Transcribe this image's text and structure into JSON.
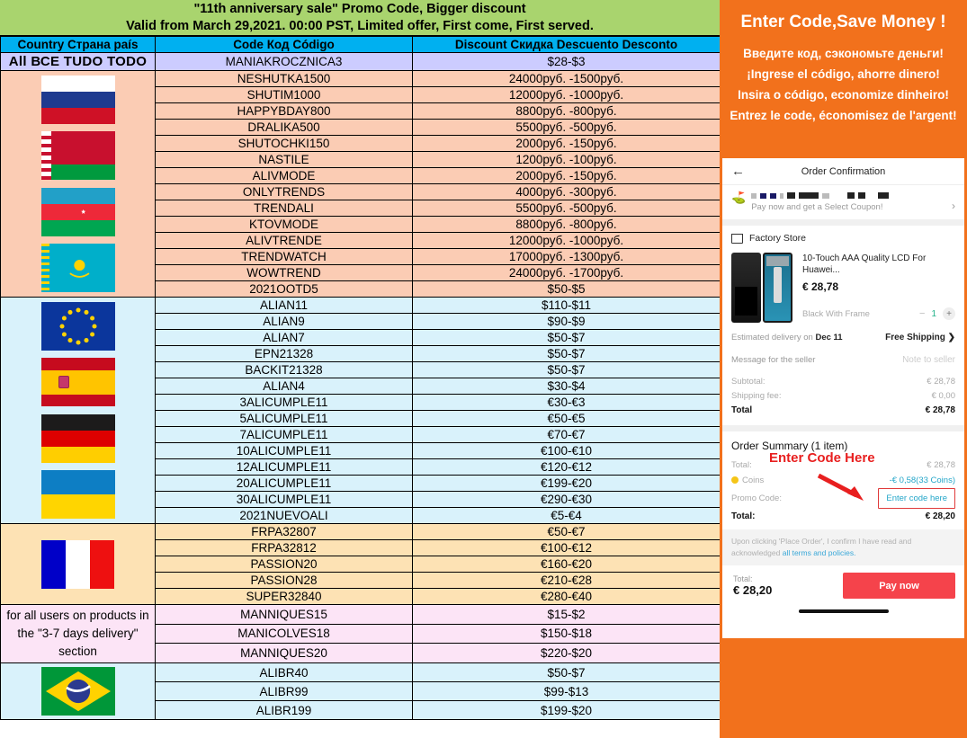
{
  "banner": {
    "line1": "\"11th anniversary sale\" Promo Code, Bigger discount",
    "line2": "Valid from March 29,2021. 00:00 PST, Limited offer, First come, First served."
  },
  "table": {
    "headers": {
      "country": "Country Страна país",
      "code": "Code Код Código",
      "discount": "Discount Скидка Descuento Desconto"
    },
    "all_row": {
      "label": "All ВСЕ TUDO TODO",
      "code": "MANIAKROCZNICA3",
      "discount": "$28-$3"
    },
    "sections": [
      {
        "id": "ru",
        "flags": [
          "russia",
          "belarus",
          "azerbaijan",
          "kazakhstan"
        ],
        "note": "",
        "rows": [
          {
            "code": "NESHUTKA1500",
            "discount": "24000руб. -1500руб."
          },
          {
            "code": "SHUTIM1000",
            "discount": "12000руб. -1000руб."
          },
          {
            "code": "HAPPYBDAY800",
            "discount": "8800руб. -800руб."
          },
          {
            "code": "DRALIKA500",
            "discount": "5500руб. -500руб."
          },
          {
            "code": "SHUTOCHKI150",
            "discount": "2000руб. -150руб."
          },
          {
            "code": "NASTILE",
            "discount": "1200руб. -100руб."
          },
          {
            "code": "ALIVMODE",
            "discount": "2000руб. -150руб."
          },
          {
            "code": "ONLYTRENDS",
            "discount": "4000руб. -300руб."
          },
          {
            "code": "TRENDALI",
            "discount": "5500руб. -500руб."
          },
          {
            "code": "KTOVMODE",
            "discount": "8800руб. -800руб."
          },
          {
            "code": "ALIVTRENDE",
            "discount": "12000руб. -1000руб."
          },
          {
            "code": "TRENDWATCH",
            "discount": "17000руб. -1300руб."
          },
          {
            "code": "WOWTREND",
            "discount": "24000руб. -1700руб."
          },
          {
            "code": "2021OOTD5",
            "discount": "$50-$5"
          }
        ]
      },
      {
        "id": "eu",
        "flags": [
          "eu",
          "spain",
          "germany",
          "ukraine"
        ],
        "note": "",
        "rows": [
          {
            "code": "ALIAN11",
            "discount": "$110-$11"
          },
          {
            "code": "ALIAN9",
            "discount": "$90-$9"
          },
          {
            "code": "ALIAN7",
            "discount": "$50-$7"
          },
          {
            "code": "EPN21328",
            "discount": "$50-$7"
          },
          {
            "code": "BACKIT21328",
            "discount": "$50-$7"
          },
          {
            "code": "ALIAN4",
            "discount": "$30-$4"
          },
          {
            "code": "3ALICUMPLE11",
            "discount": "€30-€3"
          },
          {
            "code": "5ALICUMPLE11",
            "discount": "€50-€5"
          },
          {
            "code": "7ALICUMPLE11",
            "discount": "€70-€7"
          },
          {
            "code": "10ALICUMPLE11",
            "discount": "€100-€10"
          },
          {
            "code": "12ALICUMPLE11",
            "discount": "€120-€12"
          },
          {
            "code": "20ALICUMPLE11",
            "discount": "€199-€20"
          },
          {
            "code": "30ALICUMPLE11",
            "discount": "€290-€30"
          },
          {
            "code": "2021NUEVOALI",
            "discount": "€5-€4"
          }
        ]
      },
      {
        "id": "fr",
        "flags": [
          "france"
        ],
        "note": "",
        "rows": [
          {
            "code": "FRPA32807",
            "discount": "€50-€7"
          },
          {
            "code": "FRPA32812",
            "discount": "€100-€12"
          },
          {
            "code": "PASSION20",
            "discount": "€160-€20"
          },
          {
            "code": "PASSION28",
            "discount": "€210-€28"
          },
          {
            "code": "SUPER32840",
            "discount": "€280-€40"
          }
        ]
      },
      {
        "id": "pt",
        "flags": [],
        "note": "for all users on products in the \"3-7 days delivery\" section",
        "rows": [
          {
            "code": "MANNIQUES15",
            "discount": "$15-$2"
          },
          {
            "code": "MANICOLVES18",
            "discount": "$150-$18"
          },
          {
            "code": "MANNIQUES20",
            "discount": "$220-$20"
          }
        ]
      },
      {
        "id": "br",
        "flags": [
          "brazil"
        ],
        "note": "",
        "rows": [
          {
            "code": "ALIBR40",
            "discount": "$50-$7"
          },
          {
            "code": "ALIBR99",
            "discount": "$99-$13"
          },
          {
            "code": "ALIBR199",
            "discount": "$199-$20"
          }
        ]
      }
    ]
  },
  "panel": {
    "slogan_en": "Enter Code,Save Money !",
    "slogan_ru": "Введите код, сэкономьте деньги!",
    "slogan_es": "¡Ingrese el código, ahorre dinero!",
    "slogan_pt": "Insira o código, economize dinheiro!",
    "slogan_fr": "Entrez le code, économisez de l'argent!",
    "accent_color": "#f2711c"
  },
  "phone": {
    "header_title": "Order Confirmation",
    "back_icon": "←",
    "coupon_subtitle": "Pay now and get a Select Coupon!",
    "chevron": "›",
    "store_name": "Factory Store",
    "item": {
      "title": "10-Touch AAA Quality LCD For Huawei...",
      "price": "€ 28,78",
      "variant": "Black With Frame",
      "qty_minus": "−",
      "qty": "1",
      "qty_plus": "+"
    },
    "delivery_label": "Estimated delivery on",
    "delivery_date": "Dec  11",
    "shipping": "Free Shipping ❯",
    "message_label": "Message for the seller",
    "message_placeholder": "Note to seller",
    "summary": {
      "subtotal_label": "Subtotal:",
      "subtotal_value": "€ 28,78",
      "shipping_label": "Shipping fee:",
      "shipping_value": "€ 0,00",
      "total_label": "Total",
      "total_value": "€ 28,78"
    },
    "order_summary_title": "Order Summary (1 item)",
    "order_summary": {
      "total_label": "Total:",
      "total_value": "€ 28,78",
      "coins_label": "Coins",
      "coins_value": "-€ 0,58(33 Coins)",
      "promo_label": "Promo Code:",
      "promo_placeholder": "Enter code here",
      "final_label": "Total:",
      "final_value": "€ 28,20"
    },
    "annotation": "Enter Code Here",
    "annotation_color": "#e81f1f",
    "terms_text": "Upon clicking 'Place Order', I confirm I have read and acknowledged ",
    "terms_link": "all terms and policies.",
    "pay_total_label": "Total:",
    "pay_total_value": "€ 28,20",
    "pay_button": "Pay now"
  }
}
